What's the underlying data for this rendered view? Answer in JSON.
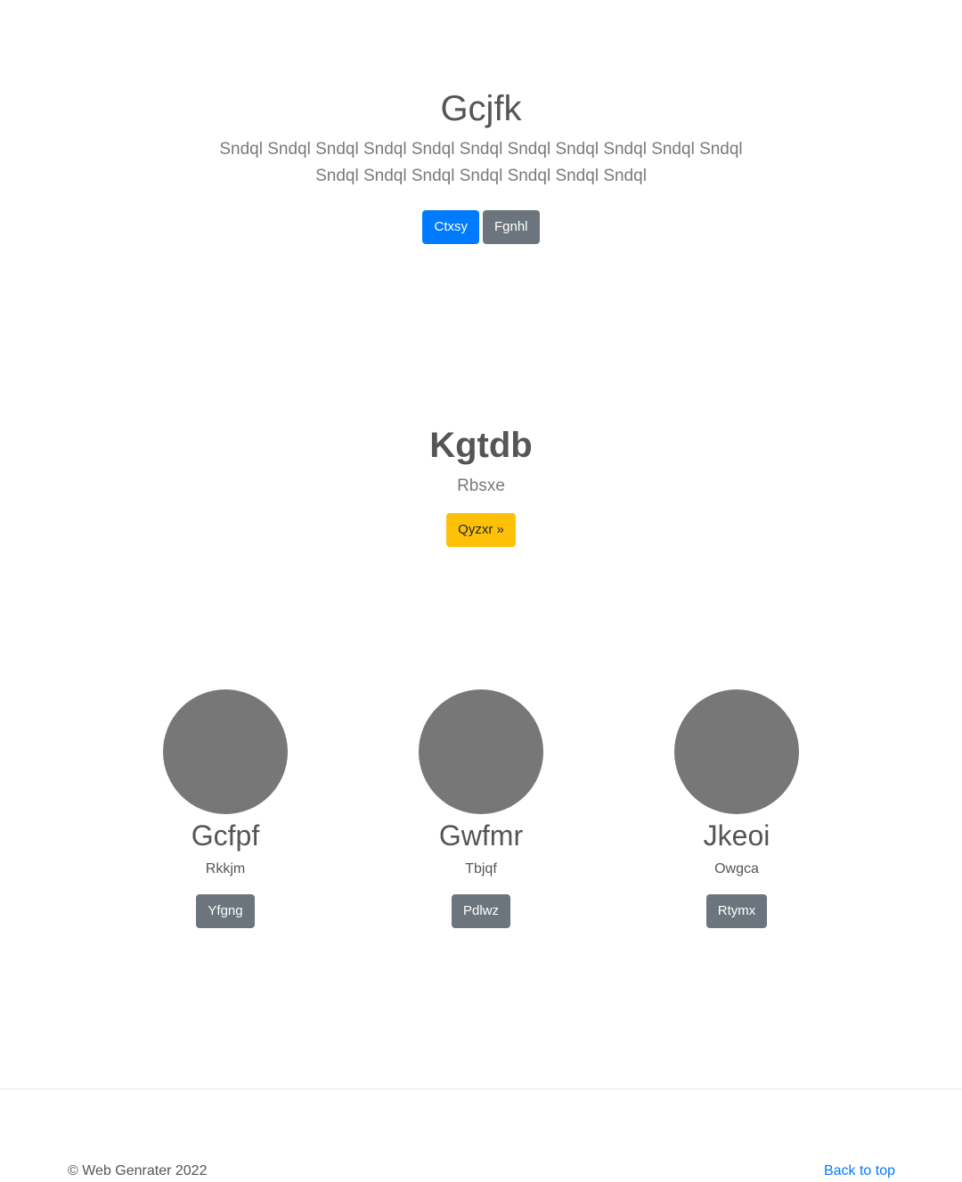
{
  "hero": {
    "title": "Gcjfk",
    "lead": "Sndql Sndql Sndql Sndql Sndql Sndql Sndql Sndql Sndql Sndql Sndql Sndql Sndql Sndql Sndql Sndql Sndql Sndql",
    "primary_button": "Ctxsy",
    "secondary_button": "Fgnhl"
  },
  "feature": {
    "title": "Kgtdb",
    "subtitle": "Rbsxe",
    "button": "Qyzxr »"
  },
  "cards": [
    {
      "name": "Gcfpf",
      "subtitle": "Rkkjm",
      "button": "Yfgng"
    },
    {
      "name": "Gwfmr",
      "subtitle": "Tbjqf",
      "button": "Pdlwz"
    },
    {
      "name": "Jkeoi",
      "subtitle": "Owgca",
      "button": "Rtymx"
    }
  ],
  "footer": {
    "copyright": "© Web Genrater 2022",
    "back_to_top": "Back to top"
  },
  "colors": {
    "primary": "#007bff",
    "secondary": "#6c757d",
    "warning": "#ffc107",
    "avatar_placeholder": "#777777"
  }
}
